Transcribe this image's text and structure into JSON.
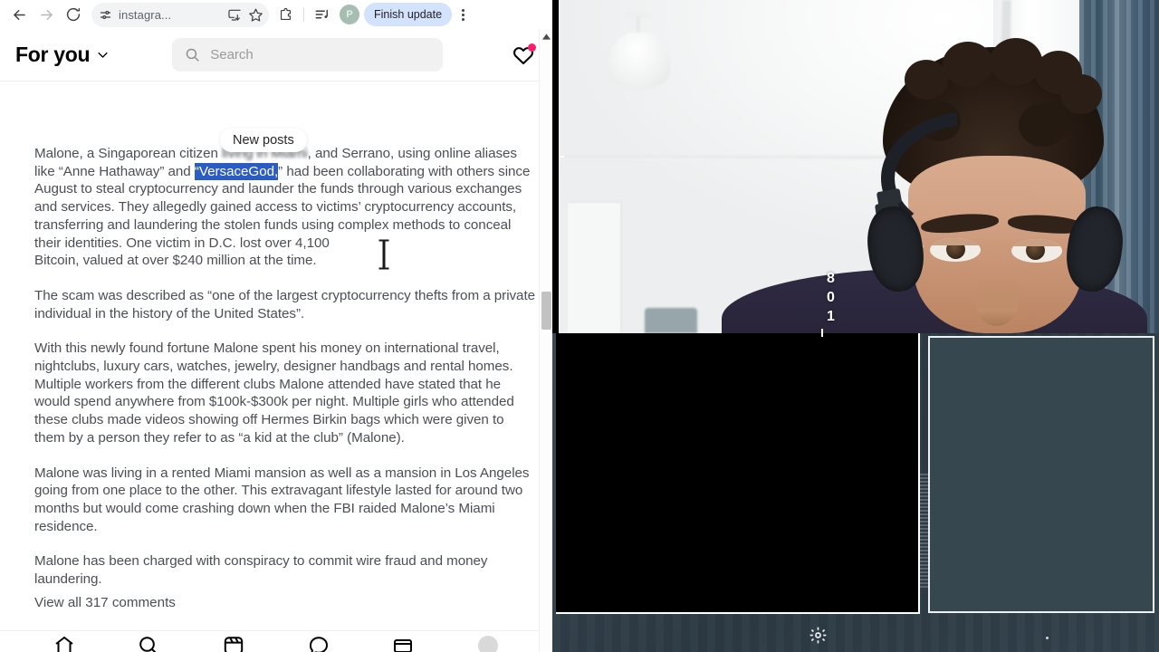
{
  "browser": {
    "nav": {
      "back_icon": "arrow-left-icon",
      "forward_icon": "arrow-right-icon",
      "reload_icon": "reload-icon"
    },
    "omnibox": {
      "site_settings_icon": "tune-icon",
      "url_text": "instagra...",
      "install_icon": "install-app-icon",
      "bookmark_icon": "star-icon"
    },
    "right": {
      "extensions_icon": "extensions-puzzle-icon",
      "media_icon": "media-playlist-icon",
      "avatar_initial": "P",
      "update_label": "Finish update",
      "menu_icon": "kebab-menu-icon"
    }
  },
  "instagram": {
    "header": {
      "feed_selector_label": "For you",
      "chevron_icon": "chevron-down-icon",
      "search_icon": "search-icon",
      "search_placeholder": "Search",
      "search_value": "",
      "activity_icon": "heart-icon",
      "activity_badge": ""
    },
    "new_posts_pill": "New posts",
    "post": {
      "paragraphs": [
        "Malone, a Singaporean citizen living in Miami, and Serrano, using online aliases like “Anne Hathaway” and “VersaceGod,” had been collaborating with others since August to steal cryptocurrency and launder the funds through various exchanges and services. They allegedly gained access to victims’ cryptocurrency accounts, transferring and laundering the stolen funds using complex methods to conceal their identities. One victim in D.C. lost over 4,100",
        "Bitcoin, valued at over $240 million at the time.",
        "The scam was described as “one of the largest cryptocurrency thefts from a private individual in the history of the United States”.",
        "With this newly found fortune Malone spent his money on international travel, nightclubs, luxury cars, watches, jewelry, designer handbags and rental homes. Multiple workers from the different clubs Malone attended have stated that he would spend anywhere from $100k-$300k per night. Multiple girls who attended these clubs made videos showing off Hermes Birkin bags which were given to them by a person they refer to as “a kid at the club” (Malone).",
        "Malone was living in a rented Miami mansion as well as a mansion in Los Angeles going from one place to the other. This extravagant lifestyle lasted for around two months but would come crashing down when the FBI raided Malone’s Miami residence.",
        "Malone has been charged with conspiracy to commit wire fraud and money laundering."
      ],
      "selected_text": "“VersaceGod,”",
      "selection_color": "#2b5cc4",
      "view_comments_label": "View all 317 comments"
    },
    "bottom_nav": [
      {
        "name": "home-icon",
        "label": "Home"
      },
      {
        "name": "search-icon",
        "label": "Search"
      },
      {
        "name": "reels-icon",
        "label": "Reels"
      },
      {
        "name": "messages-icon",
        "label": "Messages"
      },
      {
        "name": "notifications-icon",
        "label": "Notifications"
      },
      {
        "name": "profile-avatar-icon",
        "label": "Profile"
      }
    ],
    "scrollbar": {
      "up_arrow_icon": "scroll-up-arrow-icon",
      "thumb": "scrollbar-thumb"
    }
  },
  "stream": {
    "webcam_overlay_digits": "8\n0\n1",
    "settings_icon": "sun-settings-icon",
    "panels": {
      "left_panel": "black-video-panel",
      "right_panel": "dark-preview-panel"
    }
  },
  "colors": {
    "accent_blue": "#2b5cc4",
    "badge_pink": "#ff1d6b",
    "update_pill": "#d3e3fd",
    "panel_dark": "#36474f",
    "stream_bg": "#2f3d47"
  }
}
